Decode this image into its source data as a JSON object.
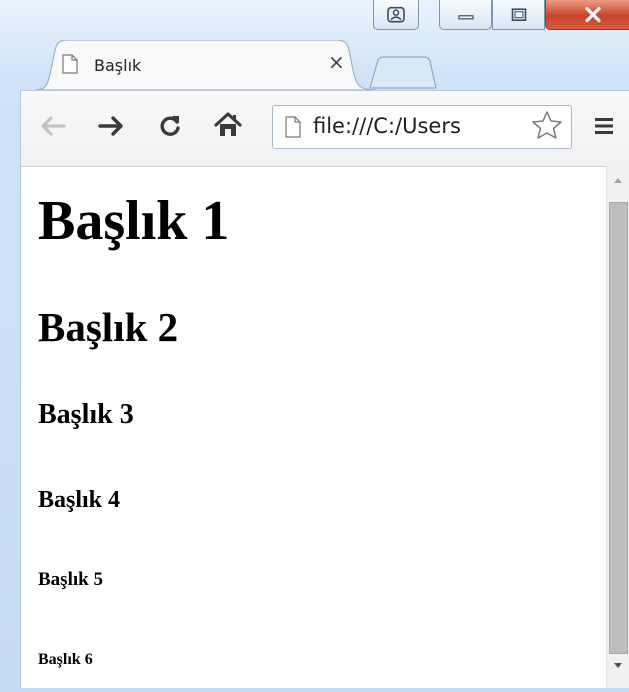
{
  "window": {
    "controls": [
      "user-icon",
      "minimize-icon",
      "maximize-icon",
      "close-icon"
    ],
    "colors": {
      "frame": "#c6dcf4",
      "close": "#c7442a"
    }
  },
  "tab": {
    "title": "Başlık",
    "close_glyph": "×",
    "icon": "page-icon"
  },
  "toolbar": {
    "back_icon": "back-arrow-icon",
    "forward_icon": "forward-arrow-icon",
    "reload_icon": "reload-icon",
    "home_icon": "home-icon",
    "address": "file:///C:/Users",
    "star_icon": "star-icon",
    "menu_icon": "menu-icon"
  },
  "page": {
    "h1": "Başlık 1",
    "h2": "Başlık 2",
    "h3": "Başlık 3",
    "h4": "Başlık 4",
    "h5": "Başlık 5",
    "h6": "Başlık 6"
  }
}
